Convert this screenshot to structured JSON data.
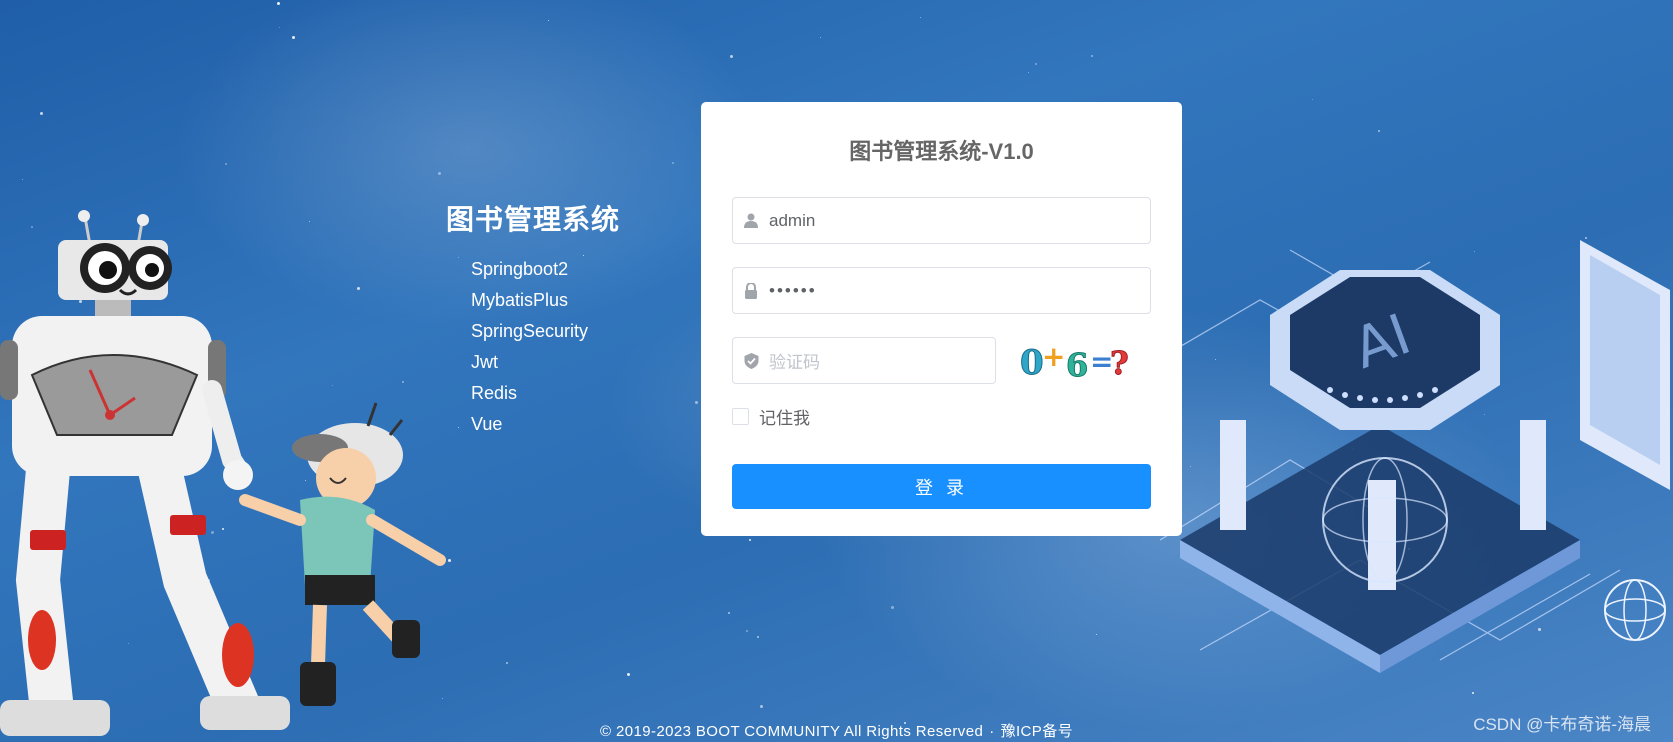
{
  "intro": {
    "title": "图书管理系统",
    "tech_stack": [
      "Springboot2",
      "MybatisPlus",
      "SpringSecurity",
      "Jwt",
      "Redis",
      "Vue"
    ]
  },
  "login_form": {
    "title": "图书管理系统-V1.0",
    "username": {
      "value": "admin",
      "icon": "user-icon"
    },
    "password": {
      "value": "••••••",
      "icon": "lock-icon"
    },
    "captcha": {
      "placeholder": "验证码",
      "icon": "shield-check-icon",
      "image_text": "0+6=?"
    },
    "remember_me": {
      "label": "记住我",
      "checked": false
    },
    "submit_label": "登 录"
  },
  "footer": {
    "copyright": "© 2019-2023 BOOT COMMUNITY All Rights Reserved",
    "separator": "·",
    "icp": "豫ICP备号"
  },
  "watermark": "CSDN @卡布奇诺-海晨",
  "colors": {
    "primary_button": "#1890ff",
    "background": "#2c6db3",
    "card": "#ffffff"
  }
}
